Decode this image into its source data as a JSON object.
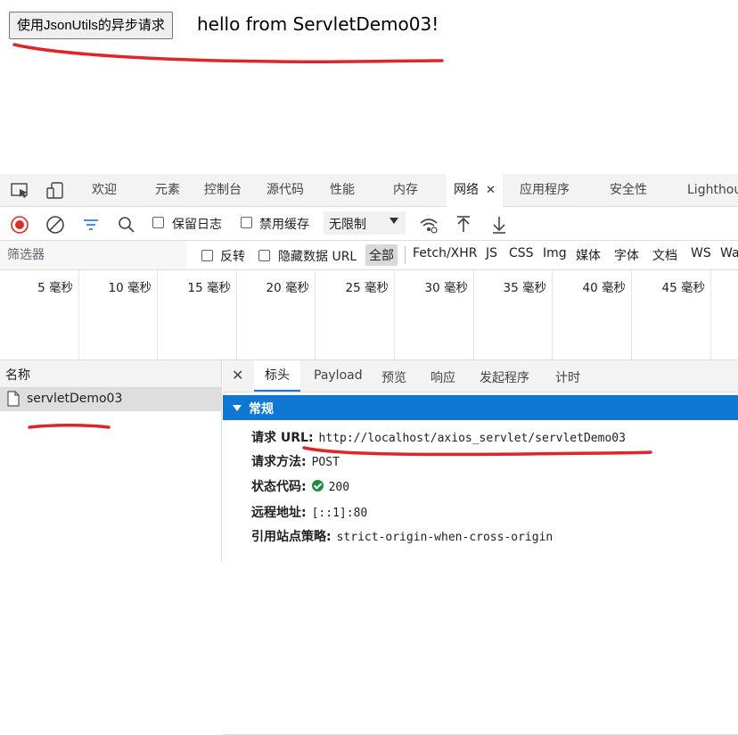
{
  "page": {
    "button_label": "使用JsonUtils的异步请求",
    "response_text": "hello from ServletDemo03!"
  },
  "devtools": {
    "tabs": [
      "欢迎",
      "元素",
      "控制台",
      "源代码",
      "性能",
      "内存",
      "网络",
      "应用程序",
      "安全性",
      "Lighthou"
    ],
    "active_tab": "网络",
    "tab_close": "✕",
    "toolbar": {
      "preserve_log": "保留日志",
      "disable_cache": "禁用缓存",
      "throttle": "无限制"
    },
    "filter": {
      "placeholder": "筛选器",
      "invert": "反转",
      "hide_data_urls": "隐藏数据 URL",
      "types": [
        "全部",
        "Fetch/XHR",
        "JS",
        "CSS",
        "Img",
        "媒体",
        "字体",
        "文档",
        "WS",
        "Wa"
      ]
    },
    "timeline_ticks": [
      "5 毫秒",
      "10 毫秒",
      "15 毫秒",
      "20 毫秒",
      "25 毫秒",
      "30 毫秒",
      "35 毫秒",
      "40 毫秒",
      "45 毫秒"
    ],
    "requests": {
      "column_name": "名称",
      "items": [
        "servletDemo03"
      ]
    },
    "details": {
      "close": "✕",
      "tabs": [
        "标头",
        "Payload",
        "预览",
        "响应",
        "发起程序",
        "计时"
      ],
      "section": "常规",
      "general": [
        {
          "key": "请求 URL:",
          "value": "http://localhost/axios_servlet/servletDemo03"
        },
        {
          "key": "请求方法:",
          "value": "POST"
        },
        {
          "key": "状态代码:",
          "value": "200"
        },
        {
          "key": "远程地址:",
          "value": "[::1]:80"
        },
        {
          "key": "引用站点策略:",
          "value": "strict-origin-when-cross-origin"
        }
      ]
    }
  },
  "colors": {
    "accent": "#0e78d4",
    "annotation": "#e0242b",
    "record": "#d93025",
    "status_ok": "#1e8e3e"
  }
}
